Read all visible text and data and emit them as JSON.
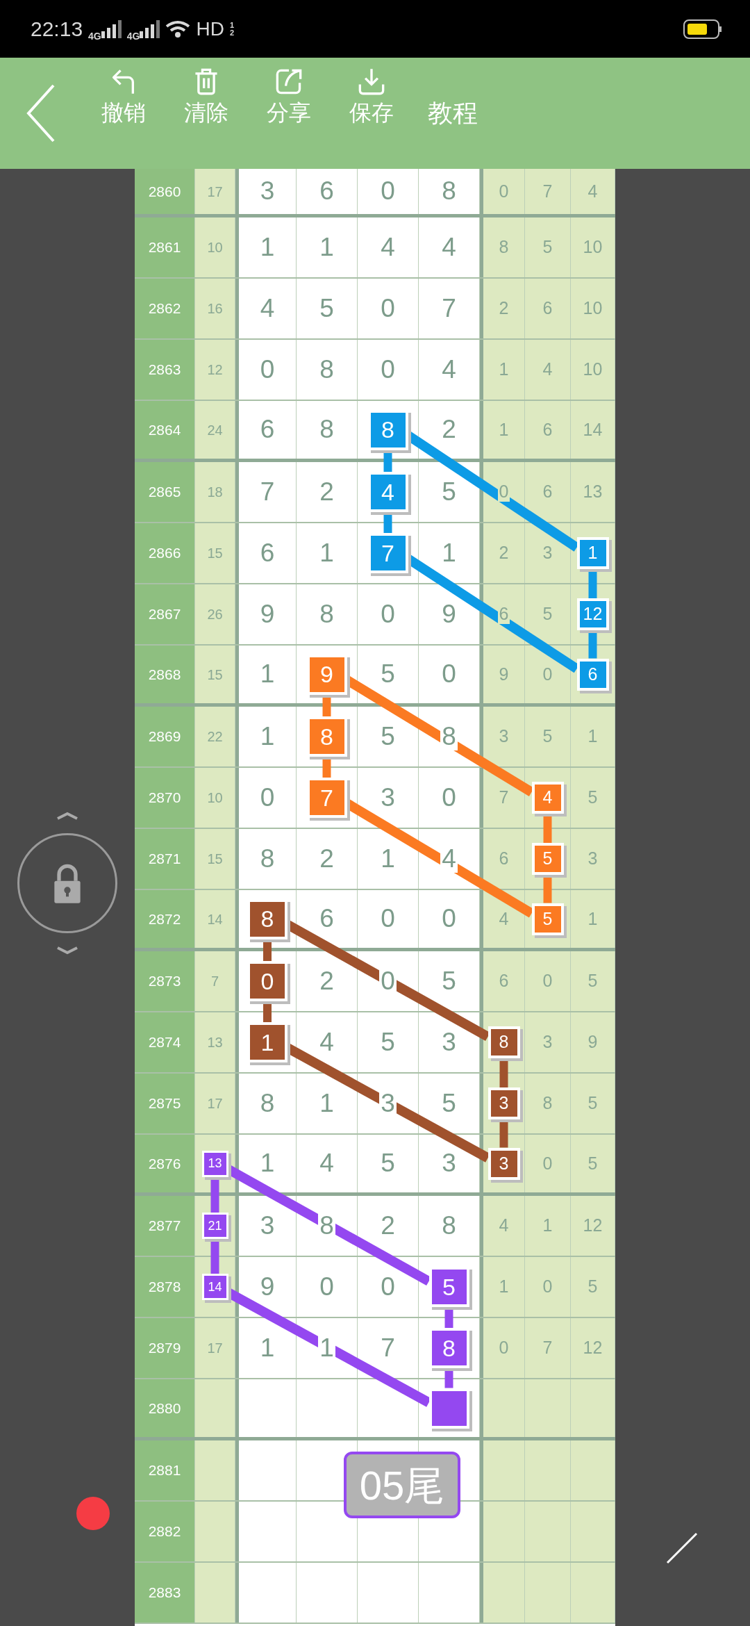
{
  "status_bar": {
    "time": "22:13",
    "signals": [
      {
        "label": "4G"
      },
      {
        "label": "4G"
      }
    ],
    "hd": "HD",
    "hd_slots": [
      "1",
      "2"
    ]
  },
  "toolbar": {
    "actions": [
      {
        "label": "撤销",
        "kind": "undo"
      },
      {
        "label": "清除",
        "kind": "clear"
      },
      {
        "label": "分享",
        "kind": "share"
      },
      {
        "label": "保存",
        "kind": "save"
      }
    ],
    "help": "教程"
  },
  "rows": [
    {
      "issue": "2860",
      "cells": [
        "17",
        "3",
        "6",
        "0",
        "8",
        "0",
        "7",
        "4"
      ]
    },
    {
      "issue": "2861",
      "cells": [
        "10",
        "1",
        "1",
        "4",
        "4",
        "8",
        "5",
        "10"
      ]
    },
    {
      "issue": "2862",
      "cells": [
        "16",
        "4",
        "5",
        "0",
        "7",
        "2",
        "6",
        "10"
      ]
    },
    {
      "issue": "2863",
      "cells": [
        "12",
        "0",
        "8",
        "0",
        "4",
        "1",
        "4",
        "10"
      ]
    },
    {
      "issue": "2864",
      "cells": [
        "24",
        "6",
        "8",
        {
          "kind": "mark",
          "text": "8",
          "color": "#0d9be6"
        },
        "2",
        "1",
        "6",
        "14"
      ]
    },
    {
      "issue": "2865",
      "cells": [
        "18",
        "7",
        "2",
        {
          "kind": "mark",
          "text": "4",
          "color": "#0d9be6"
        },
        "5",
        "0",
        "6",
        "13"
      ]
    },
    {
      "issue": "2866",
      "cells": [
        "15",
        "6",
        "1",
        {
          "kind": "mark",
          "text": "7",
          "color": "#0d9be6"
        },
        "1",
        "2",
        "3",
        {
          "kind": "mark",
          "text": "1",
          "color": "#0d9be6"
        }
      ]
    },
    {
      "issue": "2867",
      "cells": [
        "26",
        "9",
        "8",
        "0",
        "9",
        "6",
        "5",
        {
          "kind": "mark",
          "text": "12",
          "color": "#0d9be6"
        }
      ]
    },
    {
      "issue": "2868",
      "cells": [
        "15",
        "1",
        {
          "kind": "mark",
          "text": "9",
          "color": "#fb7a22"
        },
        "5",
        "0",
        "9",
        "0",
        {
          "kind": "mark",
          "text": "6",
          "color": "#0d9be6"
        }
      ]
    },
    {
      "issue": "2869",
      "cells": [
        "22",
        "1",
        {
          "kind": "mark",
          "text": "8",
          "color": "#fb7a22"
        },
        "5",
        "8",
        "3",
        "5",
        "1"
      ]
    },
    {
      "issue": "2870",
      "cells": [
        "10",
        "0",
        {
          "kind": "mark",
          "text": "7",
          "color": "#fb7a22"
        },
        "3",
        "0",
        "7",
        {
          "kind": "mark",
          "text": "4",
          "color": "#fb7a22"
        },
        "5"
      ]
    },
    {
      "issue": "2871",
      "cells": [
        "15",
        "8",
        "2",
        "1",
        "4",
        "6",
        {
          "kind": "mark",
          "text": "5",
          "color": "#fb7a22"
        },
        "3"
      ]
    },
    {
      "issue": "2872",
      "cells": [
        "14",
        {
          "kind": "mark",
          "text": "8",
          "color": "#a0522d"
        },
        "6",
        "0",
        "0",
        "4",
        {
          "kind": "mark",
          "text": "5",
          "color": "#fb7a22"
        },
        "1"
      ]
    },
    {
      "issue": "2873",
      "cells": [
        "7",
        {
          "kind": "mark",
          "text": "0",
          "color": "#a0522d"
        },
        "2",
        "0",
        "5",
        "6",
        "0",
        "5"
      ]
    },
    {
      "issue": "2874",
      "cells": [
        "13",
        {
          "kind": "mark",
          "text": "1",
          "color": "#a0522d"
        },
        "4",
        "5",
        "3",
        {
          "kind": "mark",
          "text": "8",
          "color": "#a0522d"
        },
        "3",
        "9"
      ]
    },
    {
      "issue": "2875",
      "cells": [
        "17",
        "8",
        "1",
        "3",
        "5",
        {
          "kind": "mark",
          "text": "3",
          "color": "#a0522d"
        },
        "8",
        "5"
      ]
    },
    {
      "issue": "2876",
      "cells": [
        {
          "kind": "mark",
          "text": "13",
          "color": "#9448f0"
        },
        "1",
        "4",
        "5",
        "3",
        {
          "kind": "mark",
          "text": "3",
          "color": "#a0522d"
        },
        "0",
        "5"
      ]
    },
    {
      "issue": "2877",
      "cells": [
        {
          "kind": "mark",
          "text": "21",
          "color": "#9448f0"
        },
        "3",
        "8",
        "2",
        "8",
        "4",
        "1",
        "12"
      ]
    },
    {
      "issue": "2878",
      "cells": [
        {
          "kind": "mark",
          "text": "14",
          "color": "#9448f0"
        },
        "9",
        "0",
        "0",
        {
          "kind": "mark",
          "text": "5",
          "color": "#9448f0"
        },
        "1",
        "0",
        "5"
      ]
    },
    {
      "issue": "2879",
      "cells": [
        "17",
        "1",
        "1",
        "7",
        {
          "kind": "mark",
          "text": "8",
          "color": "#9448f0"
        },
        "0",
        "7",
        "12"
      ]
    },
    {
      "issue": "2880",
      "cells": [
        {
          "kind": "empty"
        },
        {
          "kind": "empty"
        },
        {
          "kind": "empty"
        },
        {
          "kind": "empty"
        },
        {
          "kind": "mark",
          "color": "#9448f0"
        }
      ]
    },
    {
      "issue": "2881",
      "label": "05尾"
    },
    {
      "issue": "2882"
    },
    {
      "issue": "2883"
    }
  ]
}
